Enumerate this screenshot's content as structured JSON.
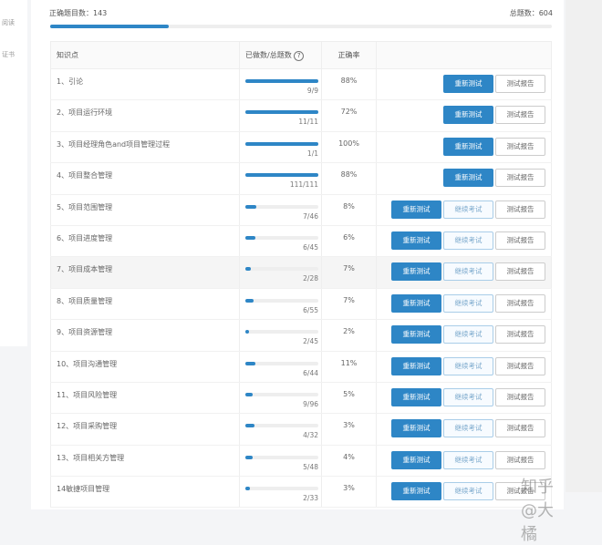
{
  "sidebar": {
    "items": [
      "阅读",
      "证书"
    ]
  },
  "summary": {
    "correct_label": "正确题目数：143",
    "total_label": "总题数：604",
    "correct": 143,
    "total": 604
  },
  "table": {
    "headers": [
      "知识点",
      "已做数/总题数",
      "正确率",
      ""
    ],
    "help_icon": "?",
    "rows": [
      {
        "name": "1、引论",
        "done": 9,
        "total": 9,
        "count": "9/9",
        "rate": "88%",
        "continue": false
      },
      {
        "name": "2、项目运行环境",
        "done": 11,
        "total": 11,
        "count": "11/11",
        "rate": "72%",
        "continue": false
      },
      {
        "name": "3、项目经理角色and项目管理过程",
        "done": 1,
        "total": 1,
        "count": "1/1",
        "rate": "100%",
        "continue": false
      },
      {
        "name": "4、项目整合管理",
        "done": 111,
        "total": 111,
        "count": "111/111",
        "rate": "88%",
        "continue": false
      },
      {
        "name": "5、项目范围管理",
        "done": 7,
        "total": 46,
        "count": "7/46",
        "rate": "8%",
        "continue": true
      },
      {
        "name": "6、项目进度管理",
        "done": 6,
        "total": 45,
        "count": "6/45",
        "rate": "6%",
        "continue": true
      },
      {
        "name": "7、项目成本管理",
        "done": 2,
        "total": 28,
        "count": "2/28",
        "rate": "7%",
        "continue": true
      },
      {
        "name": "8、项目质量管理",
        "done": 6,
        "total": 55,
        "count": "6/55",
        "rate": "7%",
        "continue": true
      },
      {
        "name": "9、项目资源管理",
        "done": 2,
        "total": 45,
        "count": "2/45",
        "rate": "2%",
        "continue": true
      },
      {
        "name": "10、项目沟通管理",
        "done": 6,
        "total": 44,
        "count": "6/44",
        "rate": "11%",
        "continue": true
      },
      {
        "name": "11、项目风险管理",
        "done": 9,
        "total": 96,
        "count": "9/96",
        "rate": "5%",
        "continue": true
      },
      {
        "name": "12、项目采购管理",
        "done": 4,
        "total": 32,
        "count": "4/32",
        "rate": "3%",
        "continue": true
      },
      {
        "name": "13、项目相关方管理",
        "done": 5,
        "total": 48,
        "count": "5/48",
        "rate": "4%",
        "continue": true
      },
      {
        "name": "14敏捷项目管理",
        "done": 2,
        "total": 33,
        "count": "2/33",
        "rate": "3%",
        "continue": true
      }
    ]
  },
  "buttons": {
    "retest": "重新测试",
    "continue": "继续考试",
    "report": "测试报告"
  },
  "watermark": "知乎 @大橘",
  "colors": {
    "accent": "#2e86c6"
  }
}
